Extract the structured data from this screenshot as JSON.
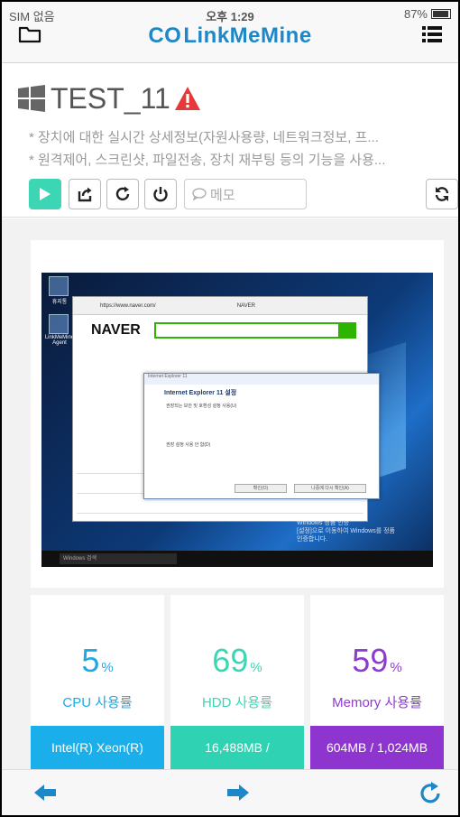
{
  "status_bar": {
    "carrier": "SIM 없음",
    "time": "오후 1:29",
    "battery": "87%"
  },
  "header": {
    "brand_logo": "CO",
    "brand_name": "LinkMeMine",
    "left_icon": "folder-icon",
    "right_icon": "menu-icon",
    "brand_color": "#1e87c8"
  },
  "device": {
    "name": "TEST_11",
    "os_icon": "windows-icon",
    "status_icon": "warning-icon",
    "description_lines": [
      "* 장치에 대한 실시간 상세정보(자원사용량, 네트워크정보, 프...",
      "* 원격제어, 스크린샷, 파일전송, 장치 재부팅 등의 기능을 사용..."
    ],
    "toolbar": {
      "memo_placeholder": "메모",
      "play_color": "#3cd6b4"
    }
  },
  "screenshot": {
    "desktop_icons": [
      "휴지통",
      "LinkMeMine Agent"
    ],
    "browser_url": "https://www.naver.com/",
    "browser_tab": "NAVER",
    "site_logo": "NAVER",
    "dialog": {
      "window_title": "Internet Explorer 11",
      "heading": "Internet Explorer 11 설정",
      "option1": "권장되는 보안 및 호환성 설정 사용(U)",
      "option2": "권장 설정 사용 안 함(D)",
      "ok_button": "확인(O)",
      "later_button": "나중에 다시 확인(A)"
    },
    "taskbar_search": "Windows 검색",
    "watermark": [
      "Windows 정품 인증",
      "[설정]으로 이동하여 Windows를 정품",
      "인증합니다."
    ]
  },
  "stats": [
    {
      "value": "5",
      "unit": "%",
      "label": "CPU 사용률",
      "footer": "Intel(R) Xeon(R)",
      "color": "#1ea9e6",
      "footer_color": "#1aaeea"
    },
    {
      "value": "69",
      "unit": "%",
      "label": "HDD 사용률",
      "footer": "16,488MB /",
      "color": "#3cd6b4",
      "footer_color": "#2fd3b3"
    },
    {
      "value": "59",
      "unit": "%",
      "label": "Memory 사용률",
      "footer": "604MB / 1,024MB",
      "color": "#8e3bd0",
      "footer_color": "#8e35cf"
    }
  ],
  "bottom_nav": {
    "back_icon": "arrow-left-icon",
    "forward_icon": "arrow-right-icon",
    "reload_icon": "reload-icon"
  }
}
